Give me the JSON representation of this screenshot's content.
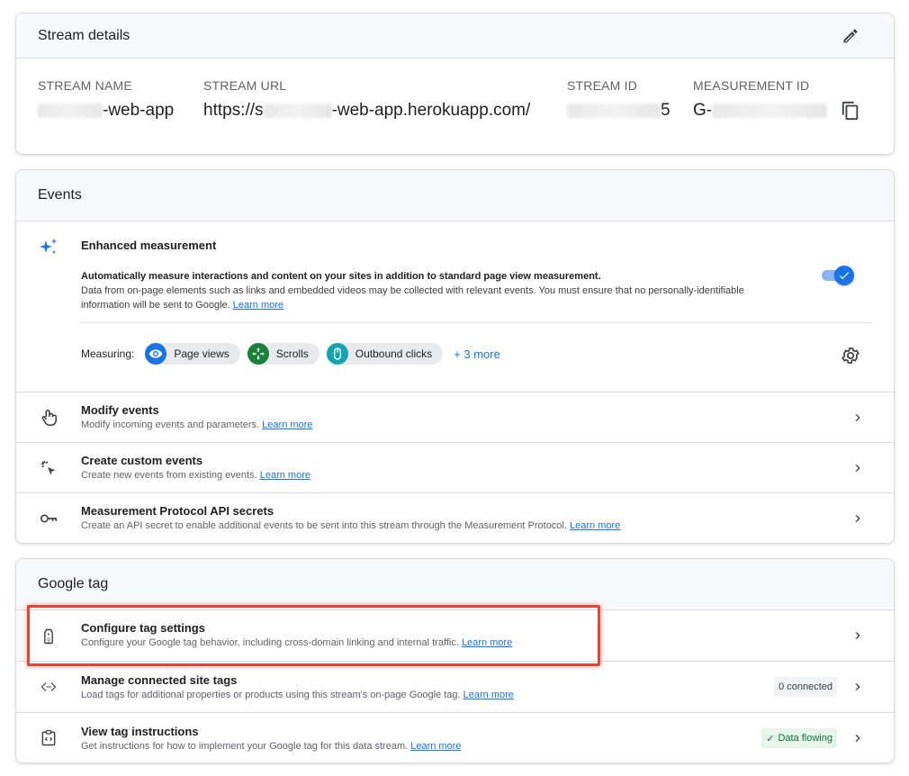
{
  "stream_details": {
    "title": "Stream details",
    "edit_icon": "pencil-icon",
    "fields": [
      {
        "label": "STREAM NAME",
        "value_visible": "-web-app"
      },
      {
        "label": "STREAM URL",
        "value_prefix": "https://s",
        "value_suffix": "-web-app.herokuapp.com/"
      },
      {
        "label": "STREAM ID",
        "value_visible": "5"
      },
      {
        "label": "MEASUREMENT ID",
        "value_prefix": "G-"
      }
    ],
    "copy_icon": "copy-icon"
  },
  "events": {
    "title": "Events",
    "enhanced": {
      "icon": "sparkle-icon",
      "title": "Enhanced measurement",
      "desc_bold": "Automatically measure interactions and content on your sites in addition to standard page view measurement.",
      "desc_text": "Data from on-page elements such as links and embedded videos may be collected with relevant events. You must ensure that no personally-identifiable information will be sent to Google.",
      "learn_more": "Learn more",
      "toggle_on": true,
      "measuring_label": "Measuring:",
      "chips": [
        {
          "label": "Page views",
          "icon": "eye-icon",
          "color": "#1a73e8"
        },
        {
          "label": "Scrolls",
          "icon": "arrows-icon",
          "color": "#188038"
        },
        {
          "label": "Outbound clicks",
          "icon": "mouse-icon",
          "color": "#12a4af"
        }
      ],
      "more": "+ 3 more",
      "settings_icon": "gear-icon"
    },
    "rows": [
      {
        "title": "Modify events",
        "sub": "Modify incoming events and parameters.",
        "learn_more": "Learn more",
        "icon": "touch-icon"
      },
      {
        "title": "Create custom events",
        "sub": "Create new events from existing events.",
        "learn_more": "Learn more",
        "icon": "cursor-click-icon"
      },
      {
        "title": "Measurement Protocol API secrets",
        "sub": "Create an API secret to enable additional events to be sent into this stream through the Measurement Protocol.",
        "learn_more": "Learn more",
        "icon": "key-icon"
      }
    ]
  },
  "google_tag": {
    "title": "Google tag",
    "rows": [
      {
        "title": "Configure tag settings",
        "sub": "Configure your Google tag behavior, including cross-domain linking and internal traffic.",
        "learn_more": "Learn more",
        "icon": "tag-icon"
      },
      {
        "title": "Manage connected site tags",
        "sub": "Load tags for additional properties or products using this stream's on-page Google tag.",
        "learn_more": "Learn more",
        "icon": "code-icon",
        "badge": "0 connected"
      },
      {
        "title": "View tag instructions",
        "sub": "Get instructions for how to implement your Google tag for this data stream.",
        "learn_more": "Learn more",
        "icon": "instructions-icon",
        "badge": "Data flowing",
        "badge_check": "✓"
      }
    ]
  },
  "colors": {
    "highlight": "#ea4335",
    "link": "#1a73e8",
    "header_bg": "#f8f9fa"
  }
}
